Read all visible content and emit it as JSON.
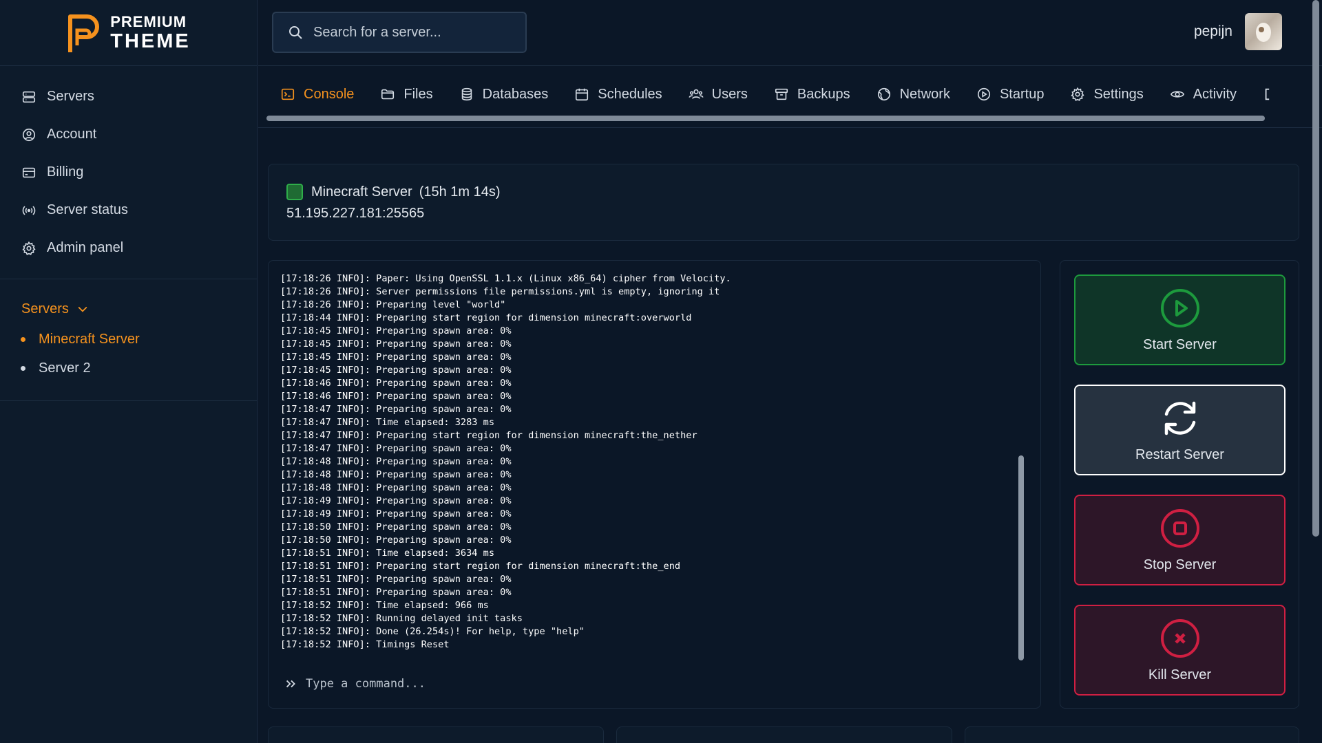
{
  "brand": {
    "line1": "PREMIUM",
    "line2": "THEME",
    "accent": "#f5921e"
  },
  "sidebar": {
    "items": [
      {
        "label": "Servers",
        "icon": "server-icon"
      },
      {
        "label": "Account",
        "icon": "user-circle-icon"
      },
      {
        "label": "Billing",
        "icon": "credit-card-icon"
      },
      {
        "label": "Server status",
        "icon": "broadcast-icon"
      },
      {
        "label": "Admin panel",
        "icon": "gear-icon"
      }
    ],
    "servers_header": "Servers",
    "servers": [
      {
        "label": "Minecraft Server",
        "active": true
      },
      {
        "label": "Server 2",
        "active": false
      }
    ]
  },
  "search": {
    "placeholder": "Search for a server..."
  },
  "user": {
    "name": "pepijn"
  },
  "tabs": [
    {
      "label": "Console",
      "icon": "terminal-icon",
      "active": true
    },
    {
      "label": "Files",
      "icon": "folder-icon"
    },
    {
      "label": "Databases",
      "icon": "database-icon"
    },
    {
      "label": "Schedules",
      "icon": "calendar-icon"
    },
    {
      "label": "Users",
      "icon": "users-icon"
    },
    {
      "label": "Backups",
      "icon": "archive-icon"
    },
    {
      "label": "Network",
      "icon": "globe-icon"
    },
    {
      "label": "Startup",
      "icon": "play-circle-icon"
    },
    {
      "label": "Settings",
      "icon": "gear-icon"
    },
    {
      "label": "Activity",
      "icon": "eye-icon"
    }
  ],
  "status": {
    "name": "Minecraft Server",
    "uptime": "(15h 1m 14s)",
    "address": "51.195.227.181:25565",
    "color": "#2fae4a"
  },
  "console": {
    "lines": [
      "[17:18:26 INFO]: Paper: Using OpenSSL 1.1.x (Linux x86_64) cipher from Velocity.",
      "[17:18:26 INFO]: Server permissions file permissions.yml is empty, ignoring it",
      "[17:18:26 INFO]: Preparing level \"world\"",
      "[17:18:44 INFO]: Preparing start region for dimension minecraft:overworld",
      "[17:18:45 INFO]: Preparing spawn area: 0%",
      "[17:18:45 INFO]: Preparing spawn area: 0%",
      "[17:18:45 INFO]: Preparing spawn area: 0%",
      "[17:18:45 INFO]: Preparing spawn area: 0%",
      "[17:18:46 INFO]: Preparing spawn area: 0%",
      "[17:18:46 INFO]: Preparing spawn area: 0%",
      "[17:18:47 INFO]: Preparing spawn area: 0%",
      "[17:18:47 INFO]: Time elapsed: 3283 ms",
      "[17:18:47 INFO]: Preparing start region for dimension minecraft:the_nether",
      "[17:18:47 INFO]: Preparing spawn area: 0%",
      "[17:18:48 INFO]: Preparing spawn area: 0%",
      "[17:18:48 INFO]: Preparing spawn area: 0%",
      "[17:18:48 INFO]: Preparing spawn area: 0%",
      "[17:18:49 INFO]: Preparing spawn area: 0%",
      "[17:18:49 INFO]: Preparing spawn area: 0%",
      "[17:18:50 INFO]: Preparing spawn area: 0%",
      "[17:18:50 INFO]: Preparing spawn area: 0%",
      "[17:18:51 INFO]: Time elapsed: 3634 ms",
      "[17:18:51 INFO]: Preparing start region for dimension minecraft:the_end",
      "[17:18:51 INFO]: Preparing spawn area: 0%",
      "[17:18:51 INFO]: Preparing spawn area: 0%",
      "[17:18:52 INFO]: Time elapsed: 966 ms",
      "[17:18:52 INFO]: Running delayed init tasks",
      "[17:18:52 INFO]: Done (26.254s)! For help, type \"help\"",
      "[17:18:52 INFO]: Timings Reset"
    ],
    "command_placeholder": "Type a command..."
  },
  "power": {
    "start": {
      "label": "Start Server",
      "icon": "play-circle-icon",
      "color": "#1d9a3d"
    },
    "restart": {
      "label": "Restart Server",
      "icon": "refresh-icon",
      "color": "#ffffff"
    },
    "stop": {
      "label": "Stop Server",
      "icon": "stop-circle-icon",
      "color": "#d01f42"
    },
    "kill": {
      "label": "Kill Server",
      "icon": "x-circle-icon",
      "color": "#d01f42"
    }
  }
}
